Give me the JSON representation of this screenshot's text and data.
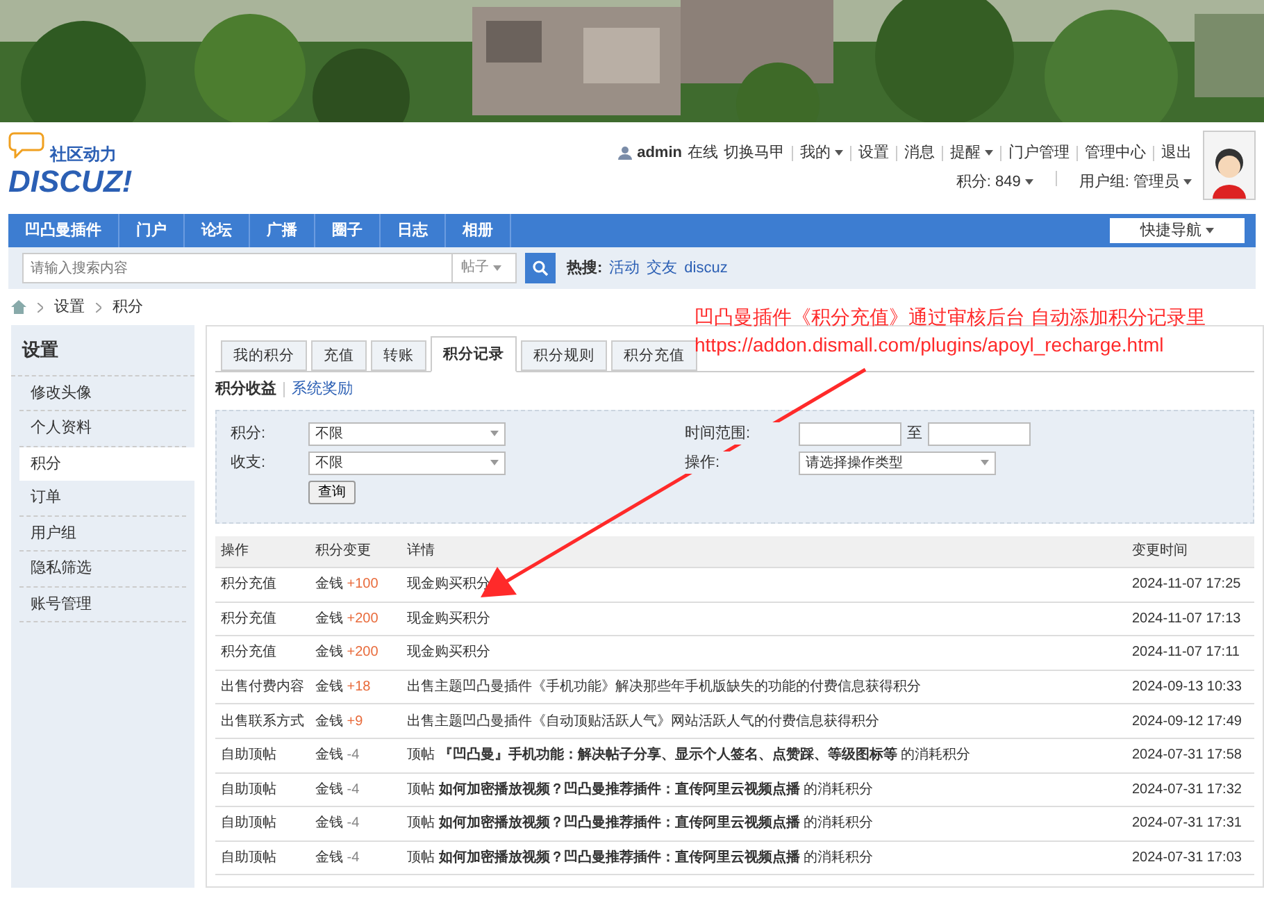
{
  "banner": {
    "kind": "picture"
  },
  "logo": {
    "tagline": "社区动力",
    "wordmark": "DISCUZ!"
  },
  "user": {
    "name": "admin",
    "status": "在线",
    "links": [
      {
        "label": "切换马甲",
        "dropdown": false
      },
      {
        "label": "我的",
        "dropdown": true
      },
      {
        "label": "设置",
        "dropdown": false
      },
      {
        "label": "消息",
        "dropdown": false
      },
      {
        "label": "提醒",
        "dropdown": true
      },
      {
        "label": "门户管理",
        "dropdown": false
      },
      {
        "label": "管理中心",
        "dropdown": false
      },
      {
        "label": "退出",
        "dropdown": false
      }
    ],
    "stats": [
      {
        "label": "积分: 849",
        "dropdown": true
      },
      {
        "label": "用户组: 管理员",
        "dropdown": true
      }
    ]
  },
  "nav": {
    "items": [
      "凹凸曼插件",
      "门户",
      "论坛",
      "广播",
      "圈子",
      "日志",
      "相册"
    ],
    "quick_nav": "快捷导航"
  },
  "search": {
    "placeholder": "请输入搜索内容",
    "scope": "帖子",
    "hot_label": "热搜:",
    "hot": [
      "活动",
      "交友",
      "discuz"
    ]
  },
  "breadcrumb": [
    "设置",
    "积分"
  ],
  "sidebar": {
    "title": "设置",
    "items": [
      {
        "label": "修改头像",
        "selected": false
      },
      {
        "label": "个人资料",
        "selected": false
      },
      {
        "label": "积分",
        "selected": true
      },
      {
        "label": "订单",
        "selected": false
      },
      {
        "label": "用户组",
        "selected": false
      },
      {
        "label": "隐私筛选",
        "selected": false
      },
      {
        "label": "账号管理",
        "selected": false
      }
    ]
  },
  "tabs": [
    {
      "label": "我的积分",
      "selected": false
    },
    {
      "label": "充值",
      "selected": false
    },
    {
      "label": "转账",
      "selected": false
    },
    {
      "label": "积分记录",
      "selected": true
    },
    {
      "label": "积分规则",
      "selected": false
    },
    {
      "label": "积分充值",
      "selected": false
    }
  ],
  "subtabs": [
    {
      "label": "积分收益",
      "selected": true
    },
    {
      "label": "系统奖励",
      "selected": false
    }
  ],
  "filters": {
    "credit": {
      "label": "积分:",
      "value": "不限"
    },
    "flow": {
      "label": "收支:",
      "value": "不限"
    },
    "time": {
      "label": "时间范围:",
      "separator": "至"
    },
    "operation": {
      "label": "操作:",
      "value": "请选择操作类型"
    },
    "button": "查询"
  },
  "table": {
    "columns": [
      "操作",
      "积分变更",
      "详情",
      "变更时间"
    ],
    "rows": [
      {
        "operation": "积分充值",
        "credit": "金钱",
        "change": "+100",
        "color": "#e86a3a",
        "detail": "现金购买积分",
        "time": "2024-11-07 17:25"
      },
      {
        "operation": "积分充值",
        "credit": "金钱",
        "change": "+200",
        "color": "#e86a3a",
        "detail": "现金购买积分",
        "time": "2024-11-07 17:13"
      },
      {
        "operation": "积分充值",
        "credit": "金钱",
        "change": "+200",
        "color": "#e86a3a",
        "detail": "现金购买积分",
        "time": "2024-11-07 17:11"
      },
      {
        "operation": "出售付费内容",
        "credit": "金钱",
        "change": "+18",
        "color": "#e86a3a",
        "detail": "出售主题凹凸曼插件《手机功能》解决那些年手机版缺失的功能的付费信息获得积分",
        "time": "2024-09-13 10:33"
      },
      {
        "operation": "出售联系方式",
        "credit": "金钱",
        "change": "+9",
        "color": "#e86a3a",
        "detail": "出售主题凹凸曼插件《自动顶贴活跃人气》网站活跃人气的付费信息获得积分",
        "time": "2024-09-12 17:49"
      },
      {
        "operation": "自助顶帖",
        "credit": "金钱",
        "change": "-4",
        "color": "#888888",
        "detail": "顶帖 **『凹凸曼』手机功能：解决帖子分享、显示个人签名、点赞踩、等级图标等** 的消耗积分",
        "time": "2024-07-31 17:58"
      },
      {
        "operation": "自助顶帖",
        "credit": "金钱",
        "change": "-4",
        "color": "#888888",
        "detail": "顶帖 **如何加密播放视频？凹凸曼推荐插件：直传阿里云视频点播** 的消耗积分",
        "time": "2024-07-31 17:32"
      },
      {
        "operation": "自助顶帖",
        "credit": "金钱",
        "change": "-4",
        "color": "#888888",
        "detail": "顶帖 **如何加密播放视频？凹凸曼推荐插件：直传阿里云视频点播** 的消耗积分",
        "time": "2024-07-31 17:31"
      },
      {
        "operation": "自助顶帖",
        "credit": "金钱",
        "change": "-4",
        "color": "#888888",
        "detail": "顶帖 **如何加密播放视频？凹凸曼推荐插件：直传阿里云视频点播** 的消耗积分",
        "time": "2024-07-31 17:03"
      }
    ]
  },
  "annotation": {
    "lines": [
      "凹凸曼插件《积分充值》通过审核后台 自动添加积分记录里",
      "https://addon.dismall.com/plugins/apoyl_recharge.html"
    ]
  }
}
